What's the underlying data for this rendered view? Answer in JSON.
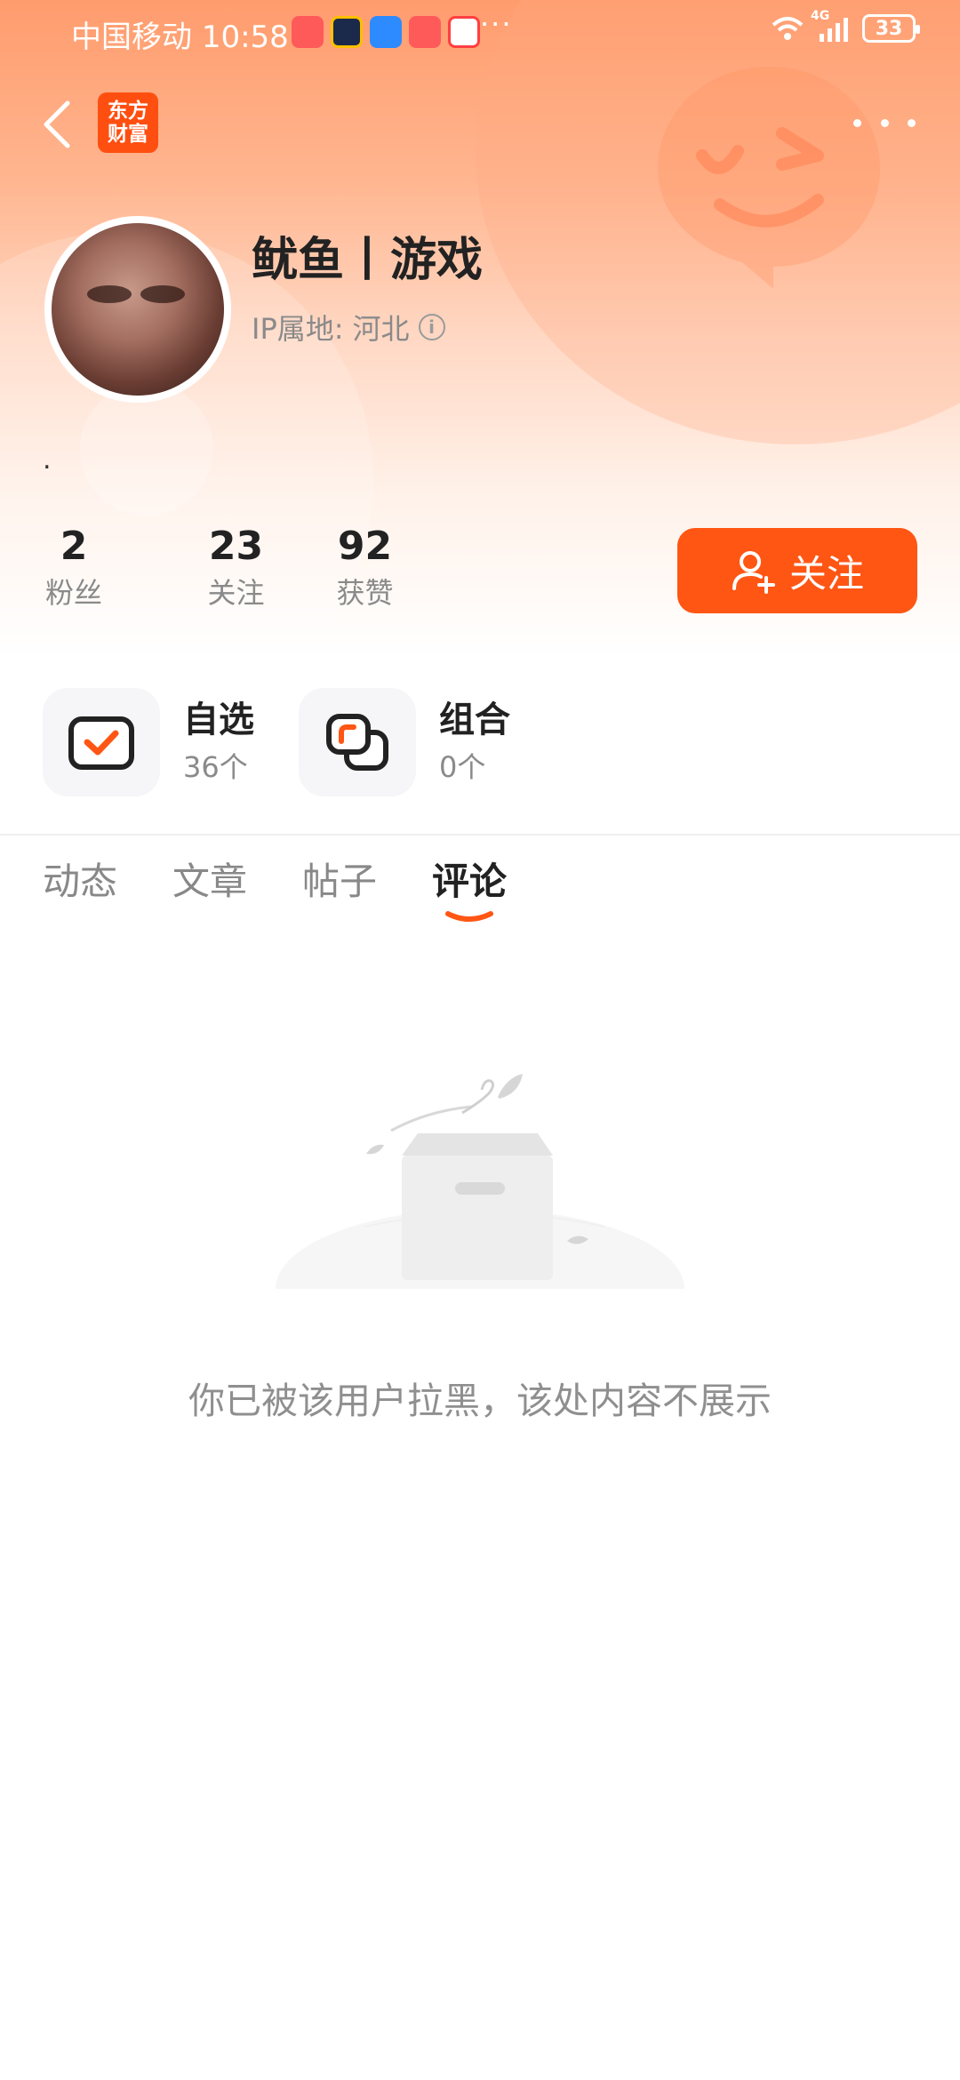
{
  "status_bar": {
    "carrier": "中国移动",
    "time": "10:58",
    "dots": "···",
    "network": "4G",
    "battery": "33"
  },
  "nav": {
    "logo_line1": "东方",
    "logo_line2": "财富"
  },
  "profile": {
    "name": "鱿鱼丨游戏",
    "ip_label": "IP属地:",
    "ip_value": "河北",
    "bio": "."
  },
  "stats": [
    {
      "value": "2",
      "label": "粉丝"
    },
    {
      "value": "23",
      "label": "关注"
    },
    {
      "value": "92",
      "label": "获赞"
    }
  ],
  "follow_button": {
    "label": "关注"
  },
  "quick_links": [
    {
      "title": "自选",
      "count": "36个"
    },
    {
      "title": "组合",
      "count": "0个"
    }
  ],
  "tabs": [
    {
      "label": "动态"
    },
    {
      "label": "文章"
    },
    {
      "label": "帖子"
    },
    {
      "label": "评论"
    }
  ],
  "active_tab": "评论",
  "empty_state": {
    "message": "你已被该用户拉黑，该处内容不展示"
  },
  "colors": {
    "accent": "#ff5614",
    "logo": "#ff4f10"
  }
}
